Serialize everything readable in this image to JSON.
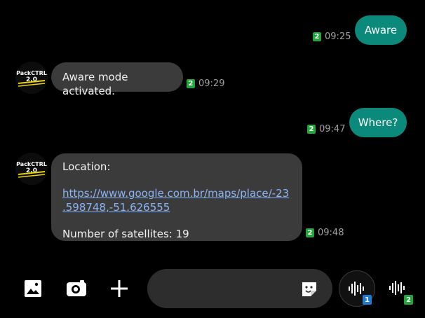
{
  "conversation": {
    "messages": [
      {
        "direction": "outgoing",
        "text": "Aware",
        "sim": "2",
        "time": "09:25"
      },
      {
        "direction": "incoming",
        "text": "Aware mode activated.",
        "sim": "2",
        "time": "09:29"
      },
      {
        "direction": "outgoing",
        "text": "Where?",
        "sim": "2",
        "time": "09:47"
      },
      {
        "direction": "incoming",
        "label": "Location:",
        "link": "https://www.google.com.br/maps/place/-23.598748,-51.626555",
        "link_line1": "https://www.google.com.br/maps/place/-23",
        "link_line2": ".598748,-51.626555",
        "extra": "Number of satellites: 19",
        "sim": "2",
        "time": "09:48"
      }
    ],
    "avatar": {
      "line1": "PackCTRL",
      "line2": "2.0"
    }
  },
  "composer": {
    "voice_buttons": [
      {
        "sim": "1",
        "color": "#1f7ad1"
      },
      {
        "sim": "2",
        "color": "#22a53a"
      }
    ]
  },
  "colors": {
    "outgoing_bubble": "#0b8a7c",
    "incoming_bubble": "#3b3b3b",
    "link": "#8ab4f8",
    "sim_badge": "#22a53a"
  }
}
